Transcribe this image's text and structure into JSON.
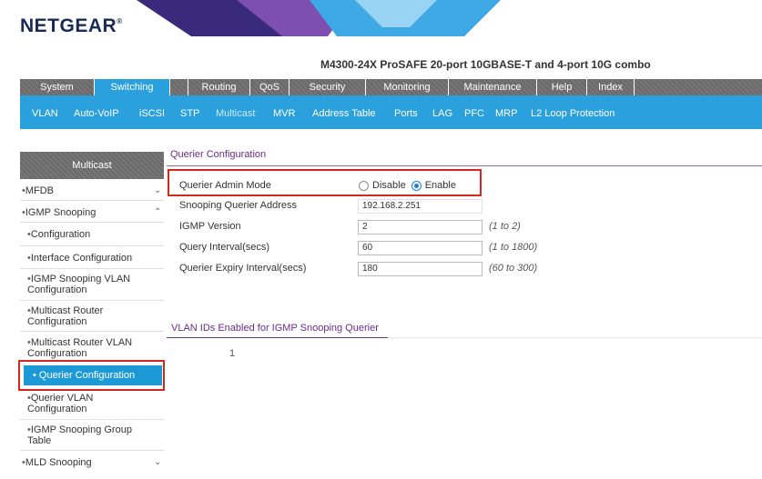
{
  "brand": {
    "logo": "NETGEAR"
  },
  "header": {
    "model_title": "M4300-24X ProSAFE 20-port 10GBASE-T and 4-port 10G combo"
  },
  "main_nav": {
    "tabs": [
      {
        "label": "System"
      },
      {
        "label": "Switching"
      },
      {
        "label": "Routing"
      },
      {
        "label": "QoS"
      },
      {
        "label": "Security"
      },
      {
        "label": "Monitoring"
      },
      {
        "label": "Maintenance"
      },
      {
        "label": "Help"
      },
      {
        "label": "Index"
      }
    ],
    "active": "Switching"
  },
  "sub_nav": {
    "items": [
      {
        "label": "VLAN"
      },
      {
        "label": "Auto-VoIP"
      },
      {
        "label": "iSCSI"
      },
      {
        "label": "STP"
      },
      {
        "label": "Multicast"
      },
      {
        "label": "MVR"
      },
      {
        "label": "Address Table"
      },
      {
        "label": "Ports"
      },
      {
        "label": "LAG"
      },
      {
        "label": "PFC"
      },
      {
        "label": "MRP"
      },
      {
        "label": "L2 Loop Protection"
      }
    ],
    "active": "Multicast"
  },
  "sidebar": {
    "header": "Multicast",
    "items": [
      {
        "label": "MFDB"
      },
      {
        "label": "IGMP Snooping"
      },
      {
        "label": "Configuration"
      },
      {
        "label": "Interface Configuration"
      },
      {
        "label": "IGMP Snooping VLAN Configuration"
      },
      {
        "label": "Multicast Router Configuration"
      },
      {
        "label": "Multicast Router VLAN Configuration"
      },
      {
        "label": "Querier Configuration"
      },
      {
        "label": "Querier VLAN Configuration"
      },
      {
        "label": "IGMP Snooping Group Table"
      },
      {
        "label": "MLD Snooping"
      }
    ],
    "active": "Querier Configuration"
  },
  "main": {
    "section_title": "Querier Configuration",
    "fields": {
      "admin_mode": {
        "label": "Querier Admin Mode",
        "options": [
          "Disable",
          "Enable"
        ],
        "selected": "Enable"
      },
      "snoop_addr": {
        "label": "Snooping Querier Address",
        "value": "192.168.2.251"
      },
      "igmp_version": {
        "label": "IGMP Version",
        "value": "2",
        "range": "(1 to 2)"
      },
      "query_interval": {
        "label": "Query Interval(secs)",
        "value": "60",
        "range": "(1 to 1800)"
      },
      "expiry_interval": {
        "label": "Querier Expiry Interval(secs)",
        "value": "180",
        "range": "(60 to 300)"
      }
    },
    "vlan_section": {
      "title": "VLAN IDs Enabled for IGMP Snooping Querier",
      "ids": [
        "1"
      ]
    }
  },
  "colors": {
    "accent": "#2aa1dc",
    "highlight_box": "#d9261c",
    "section_title": "#6a2a8a",
    "logo": "#1a2a57"
  }
}
